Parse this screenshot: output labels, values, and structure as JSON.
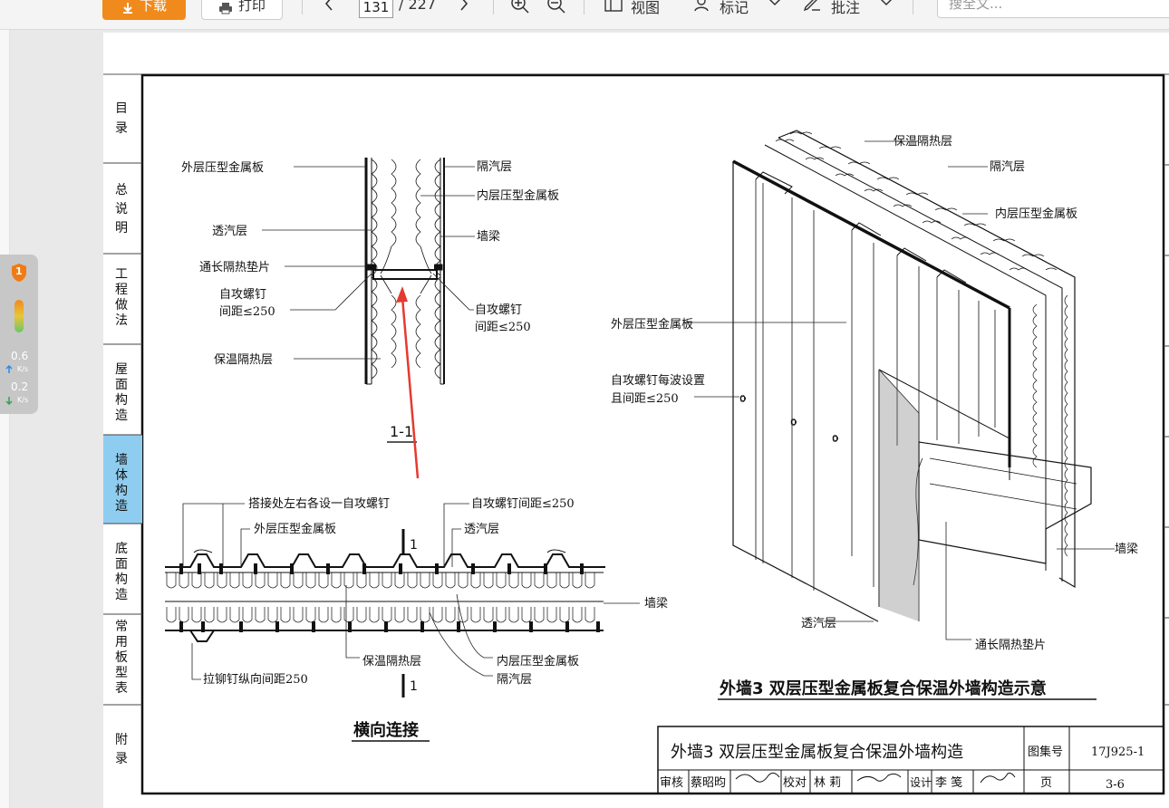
{
  "toolbar": {
    "download_label": "下载",
    "print_label": "打印",
    "prev_icon": "chevron-left-icon",
    "current_page": "131",
    "total_pages": "/ 227",
    "next_icon": "chevron-right-icon",
    "zoom_in_icon": "zoom-in-icon",
    "zoom_out_icon": "zoom-out-icon",
    "view_label": "视图",
    "mark_label": "标记",
    "annotate_label": "批注",
    "search_placeholder": "搜全文..."
  },
  "speed_widget": {
    "badge": "1",
    "upload_value": "0.6",
    "upload_unit": "K/s",
    "download_value": "0.2",
    "download_unit": "K/s"
  },
  "side_tabs": [
    {
      "label": "目录",
      "active": false
    },
    {
      "label": "总说明",
      "active": false
    },
    {
      "label": "工程做法",
      "active": false
    },
    {
      "label": "屋面构造",
      "active": false
    },
    {
      "label": "墙体构造",
      "active": true
    },
    {
      "label": "底面构造",
      "active": false
    },
    {
      "label": "常用板型表",
      "active": false
    },
    {
      "label": "附录",
      "active": false
    }
  ],
  "section_1_1": {
    "title": "1-1",
    "left_labels": [
      "外层压型金属板",
      "透汽层",
      "通长隔热垫片",
      "自攻螺钉",
      "间距≤250",
      "保温隔热层"
    ],
    "right_labels": [
      "隔汽层",
      "内层压型金属板",
      "墙梁",
      "自攻螺钉",
      "间距≤250"
    ]
  },
  "horizontal_joint": {
    "title": "横向连接",
    "labels": [
      "搭接处左右各设一自攻螺钉",
      "外层压型金属板",
      "自攻螺钉间距≤250",
      "透汽层",
      "墙梁",
      "拉铆钉纵向间距250",
      "保温隔热层",
      "内层压型金属板",
      "隔汽层"
    ],
    "section_mark": "1"
  },
  "iso_view": {
    "title": "外墙3  双层压型金属板复合保温外墙构造示意",
    "labels": [
      "保温隔热层",
      "隔汽层",
      "内层压型金属板",
      "外层压型金属板",
      "自攻螺钉每波设置",
      "且间距≤250",
      "墙梁",
      "透汽层",
      "通长隔热垫片"
    ],
    "marks": [
      "0",
      "0",
      "0"
    ]
  },
  "title_block": {
    "title": "外墙3  双层压型金属板复合保温外墙构造",
    "atlas_label": "图集号",
    "atlas_no": "17J925-1",
    "review_label": "审核",
    "reviewer": "蔡昭昀",
    "check_label": "校对",
    "checker": "林 莉",
    "design_label": "设计",
    "designer": "李 笺",
    "page_label": "页",
    "page_no": "3-6"
  }
}
